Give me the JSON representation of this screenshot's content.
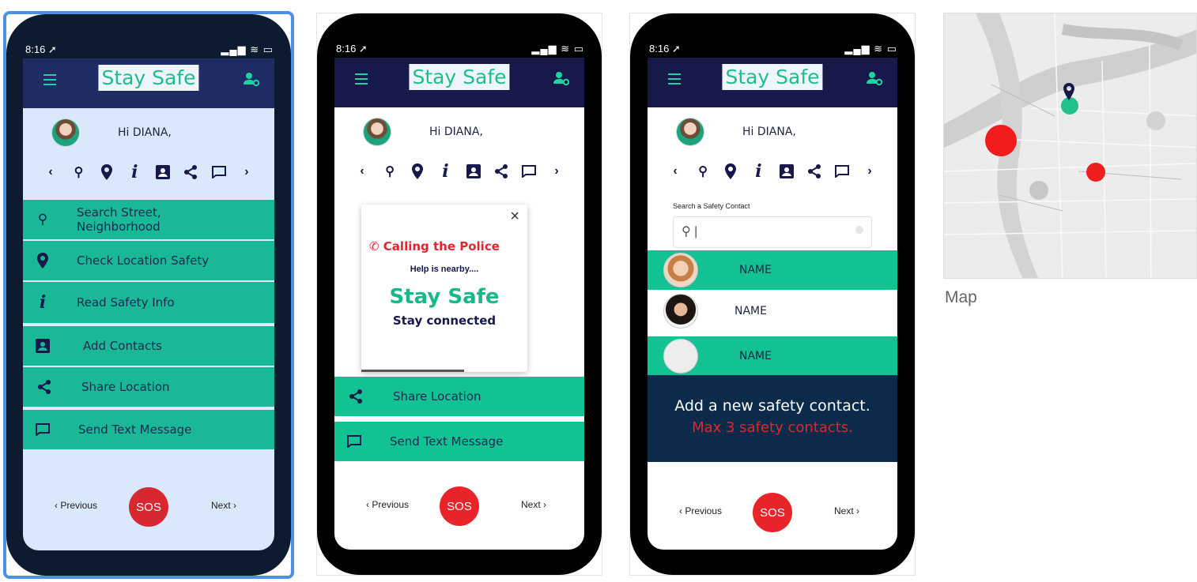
{
  "status": {
    "time": "8:16 ➚",
    "signal": "▂▄▆ ≋ ▭"
  },
  "app": {
    "title": "Stay Safe",
    "greeting": "Hi DIANA,"
  },
  "nav": {
    "previous": "‹ Previous",
    "next": "Next ›",
    "sos": "SOS"
  },
  "screen1": {
    "rows": [
      {
        "icon": "search-icon",
        "label": "Search Street, Neighborhood"
      },
      {
        "icon": "location-pin-icon",
        "label": "Check Location Safety"
      },
      {
        "icon": "info-icon",
        "label": "Read Safety Info"
      },
      {
        "icon": "contact-card-icon",
        "label": "Add Contacts"
      },
      {
        "icon": "share-icon",
        "label": "Share Location"
      },
      {
        "icon": "message-icon",
        "label": "Send Text Message"
      }
    ]
  },
  "screen2": {
    "popup": {
      "close": "×",
      "calling": "Calling the Police",
      "help": "Help is nearby....",
      "stay_safe": "Stay Safe",
      "stay_connected": "Stay connected"
    },
    "rows": [
      {
        "icon": "share-icon",
        "label": "Share Location"
      },
      {
        "icon": "message-icon",
        "label": "Send Text Message"
      }
    ]
  },
  "screen3": {
    "search_label": "Search a Safety Contact",
    "search_value": "",
    "contacts": [
      "NAME",
      "NAME",
      "NAME"
    ],
    "add_text": "Add a new safety contact.",
    "max_text": "Max 3 safety contacts."
  },
  "map": {
    "label": "Map"
  }
}
